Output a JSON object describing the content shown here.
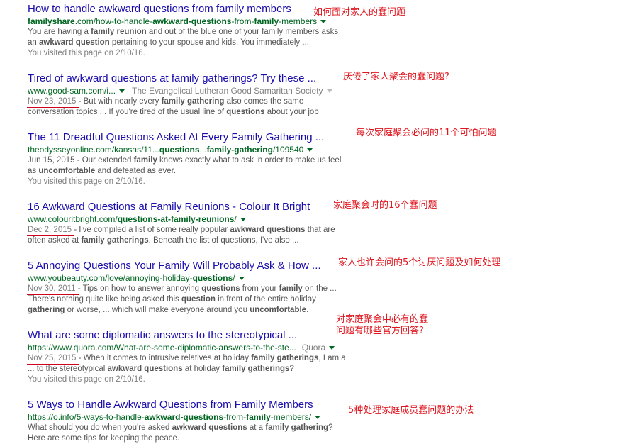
{
  "results": [
    {
      "title": "How to handle awkward questions from family members",
      "url_parts": [
        [
          "familyshare",
          true
        ],
        [
          ".com/how-to-handle-",
          false
        ],
        [
          "awkward-questions",
          true
        ],
        [
          "-from-",
          false
        ],
        [
          "family",
          true
        ],
        [
          "-members",
          false
        ]
      ],
      "snippet_lines": [
        [
          [
            "You are having a ",
            false
          ],
          [
            "family reunion",
            true
          ],
          [
            " and out of the blue one of your family members asks",
            false
          ]
        ],
        [
          [
            "an ",
            false
          ],
          [
            "awkward question",
            true
          ],
          [
            " pertaining to your spouse and kids. You immediately ...",
            false
          ]
        ]
      ],
      "visited": "You visited this page on 2/10/16.",
      "note": "如何面对家人的蠢问题"
    },
    {
      "title": "Tired of awkward questions at family gatherings? Try these ...",
      "url_parts": [
        [
          "www.good-sam.com/i...",
          false
        ]
      ],
      "source": "The Evangelical Lutheran Good Samaritan Society",
      "date": "Nov 23, 2015",
      "snippet_lines": [
        [
          [
            " - But with nearly every ",
            false
          ],
          [
            "family gathering",
            true
          ],
          [
            " also comes the same",
            false
          ]
        ],
        [
          [
            "conversation topics ... If you're tired of the usual line of ",
            false
          ],
          [
            "questions",
            true
          ],
          [
            " about your job",
            false
          ]
        ]
      ],
      "note": "厌倦了家人聚会的蠢问题?"
    },
    {
      "title": "The 11 Dreadful Questions Asked At Every Family Gathering ...",
      "url_parts": [
        [
          "theodysseyonline.com/kansas/11...",
          false
        ],
        [
          "questions",
          true
        ],
        [
          "...",
          false
        ],
        [
          "family-gathering",
          true
        ],
        [
          "/109540",
          false
        ]
      ],
      "snippet_lines": [
        [
          [
            "Jun 15, 2015 - Our extended ",
            false
          ],
          [
            "family",
            true
          ],
          [
            " knows exactly what to ask in order to make us feel",
            false
          ]
        ],
        [
          [
            "as ",
            false
          ],
          [
            "uncomfortable",
            true
          ],
          [
            " and defeated as ever.",
            false
          ]
        ]
      ],
      "visited": "You visited this page on 2/10/16.",
      "note": "每次家庭聚会必问的11个可怕问题"
    },
    {
      "title": "16 Awkward Questions at Family Reunions - Colour It Bright",
      "url_parts": [
        [
          "www.colouritbright.com/",
          false
        ],
        [
          "questions-at-family-reunions",
          true
        ],
        [
          "/",
          false
        ]
      ],
      "date": "Dec 2, 2015",
      "snippet_lines": [
        [
          [
            " - I've compiled a list of some really popular ",
            false
          ],
          [
            "awkward questions",
            true
          ],
          [
            " that are",
            false
          ]
        ],
        [
          [
            "often asked at ",
            false
          ],
          [
            "family gatherings",
            true
          ],
          [
            ". Beneath the list of questions, I've also ...",
            false
          ]
        ]
      ],
      "note": "家庭聚会时的16个蠢问题"
    },
    {
      "title": "5 Annoying Questions Your Family Will Probably Ask & How ...",
      "url_parts": [
        [
          "www.youbeauty.com/love/annoying-holiday-",
          false
        ],
        [
          "questions",
          true
        ],
        [
          "/",
          false
        ]
      ],
      "date": "Nov 30, 2011",
      "snippet_lines": [
        [
          [
            " - Tips on how to answer annoying ",
            false
          ],
          [
            "questions",
            true
          ],
          [
            " from your ",
            false
          ],
          [
            "family",
            true
          ],
          [
            " on the ...",
            false
          ]
        ],
        [
          [
            "There's nothing quite like being asked this ",
            false
          ],
          [
            "question",
            true
          ],
          [
            " in front of the entire holiday",
            false
          ]
        ],
        [
          [
            "gathering",
            true
          ],
          [
            " or worse, ... which will make everyone around you ",
            false
          ],
          [
            "uncomfortable",
            true
          ],
          [
            ".",
            false
          ]
        ]
      ],
      "note": "家人也许会问的5个讨厌问题及如何处理"
    },
    {
      "title": "What are some diplomatic answers to the stereotypical ...",
      "url_parts": [
        [
          "https://www.quora.com/What-are-some-diplomatic-answers-to-the-ste...",
          false
        ]
      ],
      "source": "Quora",
      "date": "Nov 25, 2015",
      "snippet_lines": [
        [
          [
            " - When it comes to intrusive relatives at holiday ",
            false
          ],
          [
            "family gatherings",
            true
          ],
          [
            ", I am a",
            false
          ]
        ],
        [
          [
            "... to the stereotypical ",
            false
          ],
          [
            "awkward questions",
            true
          ],
          [
            " at holiday ",
            false
          ],
          [
            "family gatherings",
            true
          ],
          [
            "?",
            false
          ]
        ]
      ],
      "visited": "You visited this page on 2/10/16.",
      "note": "对家庭聚会中必有的蠢问题有哪些官方回答?"
    },
    {
      "title": "5 Ways to Handle Awkward Questions from Family Members",
      "url_parts": [
        [
          "https://o.info/5-ways-to-handle-",
          false
        ],
        [
          "awkward-questions",
          true
        ],
        [
          "-from-",
          false
        ],
        [
          "family",
          true
        ],
        [
          "-members/",
          false
        ]
      ],
      "snippet_lines": [
        [
          [
            "What should you do when you're asked ",
            false
          ],
          [
            "awkward questions",
            true
          ],
          [
            " at a ",
            false
          ],
          [
            "family gathering",
            true
          ],
          [
            "?",
            false
          ]
        ],
        [
          [
            "Here are some tips for keeping the peace.",
            false
          ]
        ]
      ],
      "note": "5种处理家庭成员蠢问题的办法"
    }
  ]
}
